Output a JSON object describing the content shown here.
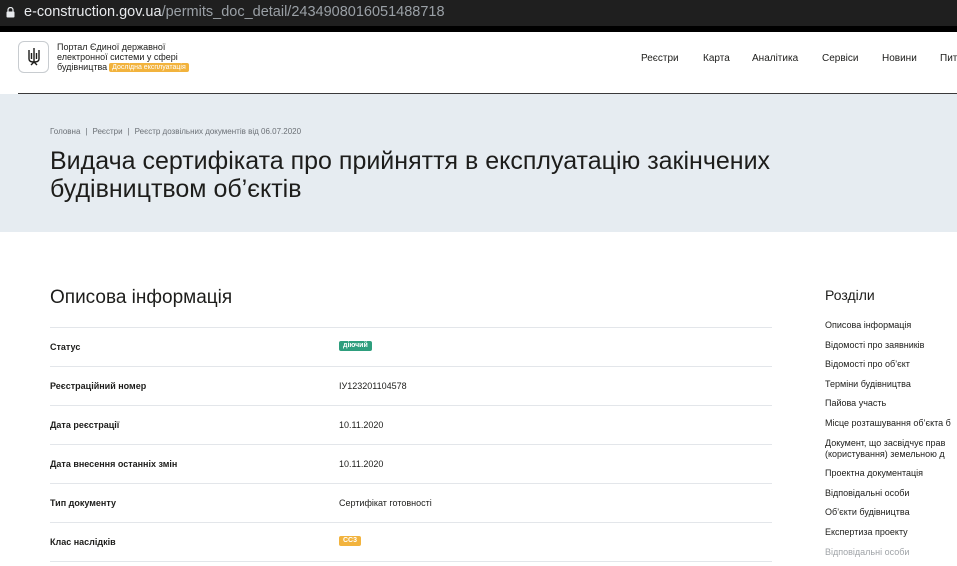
{
  "browser": {
    "host": "e-construction.gov.ua",
    "path": "/permits_doc_detail/2434908016051488718"
  },
  "header": {
    "portal_lines": [
      "Портал Єдиної державної",
      "електронної системи у сфері",
      "будівництва"
    ],
    "beta_badge": "Дослідна експлуатація",
    "nav": [
      "Реєстри",
      "Карта",
      "Аналітика",
      "Сервіси",
      "Новини",
      "Пит"
    ]
  },
  "breadcrumbs": [
    "Головна",
    "Реєстри",
    "Реєстр дозвільних документів від 06.07.2020"
  ],
  "page_title_lines": [
    "Видача сертифіката про прийняття в експлуатацію закінчених",
    "будівництвом об’єктів"
  ],
  "section_title": "Описова інформація",
  "rows": [
    {
      "label": "Статус",
      "value": "діючий",
      "badge": "green"
    },
    {
      "label": "Реєстраційний номер",
      "value": "ІУ123201104578"
    },
    {
      "label": "Дата реєстрації",
      "value": "10.11.2020"
    },
    {
      "label": "Дата внесення останніх змін",
      "value": "10.11.2020"
    },
    {
      "label": "Тип документу",
      "value": "Сертифікат готовності"
    },
    {
      "label": "Клас наслідків",
      "value": "СС3",
      "badge": "yellow"
    }
  ],
  "side": {
    "title": "Розділи",
    "items": [
      "Описова інформація",
      "Відомості про заявників",
      "Відомості про об’єкт",
      "Терміни будівництва",
      "Пайова участь",
      "Місце розташування об’єкта б",
      "Документ, що засвідчує прав",
      "(користування) земельною д",
      "Проектна документація",
      "Відповідальні особи",
      "Об’єкти будівництва",
      "Експертиза проекту",
      "Відповідальні особи"
    ]
  },
  "colors": {
    "hero_bg": "#e6ecf1",
    "status_green": "#2e9e7d",
    "accent_yellow": "#f2b33d"
  }
}
